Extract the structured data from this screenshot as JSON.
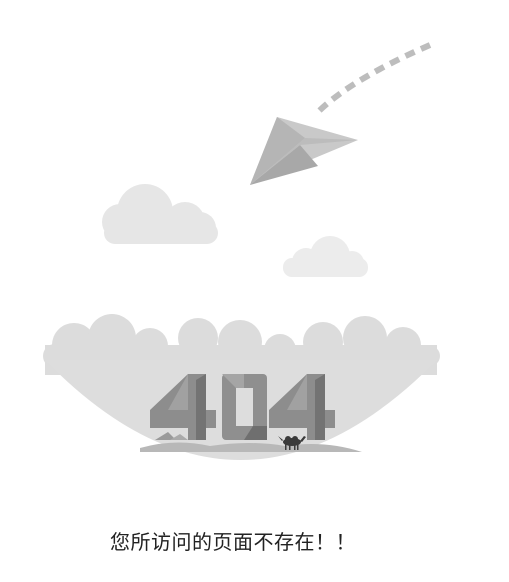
{
  "error_page": {
    "code_illustration_text": "404",
    "message": "您所访问的页面不存在！！"
  },
  "icons": {
    "plane": "paper-plane-icon",
    "cloud": "cloud-icon",
    "camel": "camel-icon"
  },
  "colors": {
    "background": "#ffffff",
    "cloud_light": "#e8e8e8",
    "cloud_mid": "#dfdfdf",
    "bowl": "#dcdcdc",
    "digits_main": "#8f8f8f",
    "digits_shade": "#6e6e6e",
    "plane_light": "#c9c9c9",
    "plane_dark": "#a8a8a8",
    "text": "#222222"
  }
}
